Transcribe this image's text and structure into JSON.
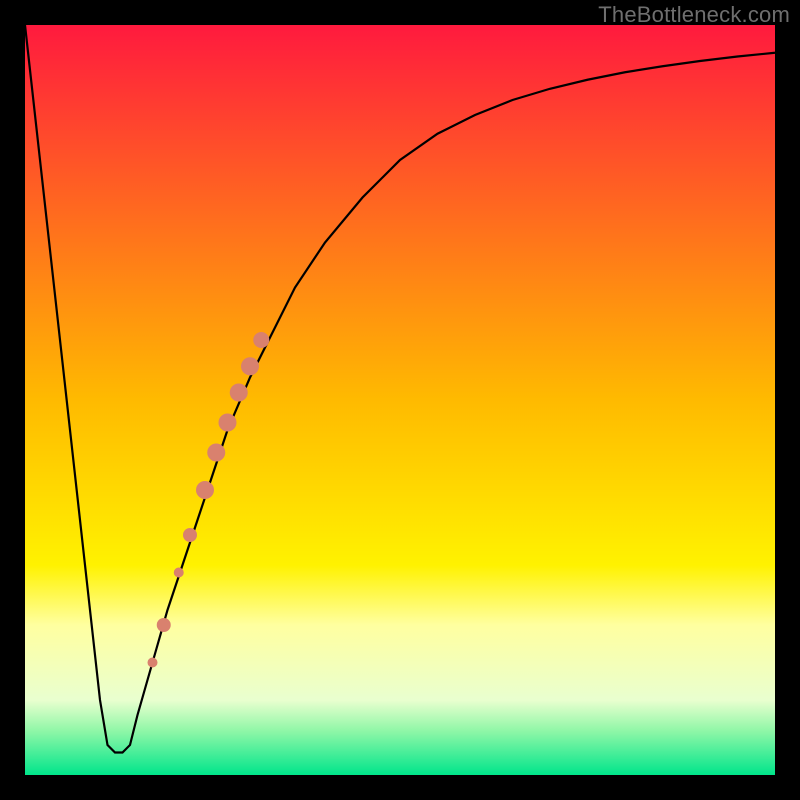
{
  "watermark": "TheBottleneck.com",
  "chart_data": {
    "type": "line",
    "title": "",
    "xlabel": "",
    "ylabel": "",
    "xlim": [
      0,
      100
    ],
    "ylim": [
      0,
      100
    ],
    "grid": false,
    "background_gradient": {
      "stops": [
        {
          "offset": 0.0,
          "color": "#ff1a3e"
        },
        {
          "offset": 0.5,
          "color": "#ffba00"
        },
        {
          "offset": 0.72,
          "color": "#fff200"
        },
        {
          "offset": 0.8,
          "color": "#ffffa0"
        },
        {
          "offset": 0.9,
          "color": "#e9ffcf"
        },
        {
          "offset": 0.94,
          "color": "#92f7a8"
        },
        {
          "offset": 1.0,
          "color": "#00e58b"
        }
      ]
    },
    "series": [
      {
        "name": "bottleneck-curve",
        "color": "#000000",
        "x": [
          0,
          1,
          2,
          3,
          4,
          5,
          6,
          7,
          8,
          9,
          10,
          11,
          12,
          13,
          14,
          15,
          17,
          19,
          21,
          23,
          25,
          27,
          30,
          33,
          36,
          40,
          45,
          50,
          55,
          60,
          65,
          70,
          75,
          80,
          85,
          90,
          95,
          100
        ],
        "y": [
          100,
          91,
          82,
          73,
          64,
          55,
          46,
          37,
          28,
          19,
          10,
          4,
          3,
          3,
          4,
          8,
          15,
          22,
          28,
          34,
          40,
          46,
          53,
          59,
          65,
          71,
          77,
          82,
          85.5,
          88,
          90,
          91.5,
          92.7,
          93.7,
          94.5,
          95.2,
          95.8,
          96.3
        ]
      }
    ],
    "markers": {
      "name": "highlighted-points",
      "color": "#d9816e",
      "points": [
        {
          "x": 17.0,
          "y": 15.0,
          "r": 5
        },
        {
          "x": 18.5,
          "y": 20.0,
          "r": 7
        },
        {
          "x": 20.5,
          "y": 27.0,
          "r": 5
        },
        {
          "x": 22.0,
          "y": 32.0,
          "r": 7
        },
        {
          "x": 24.0,
          "y": 38.0,
          "r": 9
        },
        {
          "x": 25.5,
          "y": 43.0,
          "r": 9
        },
        {
          "x": 27.0,
          "y": 47.0,
          "r": 9
        },
        {
          "x": 28.5,
          "y": 51.0,
          "r": 9
        },
        {
          "x": 30.0,
          "y": 54.5,
          "r": 9
        },
        {
          "x": 31.5,
          "y": 58.0,
          "r": 8
        }
      ]
    }
  }
}
